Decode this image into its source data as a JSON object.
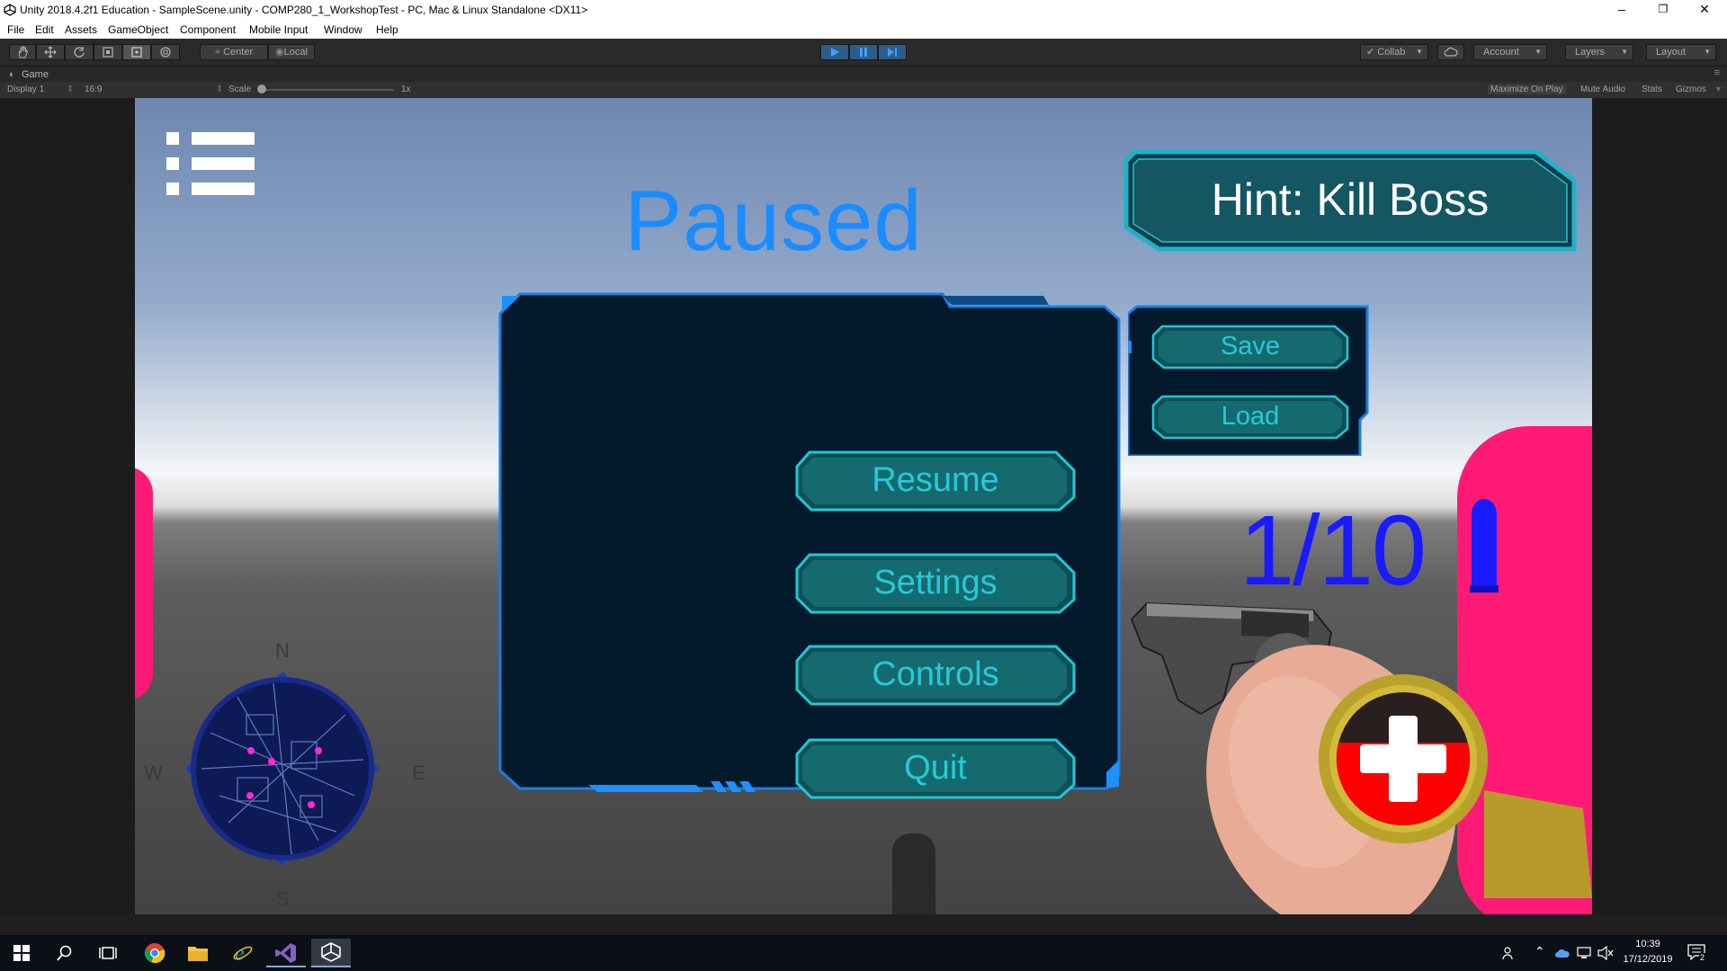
{
  "window": {
    "title": "Unity 2018.4.2f1 Education - SampleScene.unity - COMP280_1_WorkshopTest - PC, Mac & Linux Standalone <DX11>",
    "controls": {
      "minimize": "–",
      "restore": "❐",
      "close": "✕"
    }
  },
  "menu": [
    "File",
    "Edit",
    "Assets",
    "GameObject",
    "Component",
    "Mobile Input",
    "Window",
    "Help"
  ],
  "toolbar": {
    "pivot_center": "Center",
    "pivot_local": "Local",
    "collab": "Collab",
    "account": "Account",
    "layers": "Layers",
    "layout": "Layout",
    "play_state": "playing",
    "accent": "#2e5c8a"
  },
  "game_tab": {
    "label": "Game",
    "display": "Display 1",
    "aspect": "16:9",
    "scale_label": "Scale",
    "scale_value": "1x",
    "options": [
      "Maximize On Play",
      "Mute Audio",
      "Stats",
      "Gizmos"
    ]
  },
  "game": {
    "paused_title": "Paused",
    "hint": "Hint: Kill Boss",
    "menu_buttons": [
      "Resume",
      "Settings",
      "Controls",
      "Quit"
    ],
    "side_buttons": [
      "Save",
      "Load"
    ],
    "ammo": "1/10",
    "compass": {
      "n": "N",
      "e": "E",
      "s": "S",
      "w": "W"
    },
    "colors": {
      "paused": "#1a8cff",
      "button_text": "#27c9d6",
      "panel_border": "#1e90ff",
      "enemy": "#ff1a75",
      "ammo": "#1a1aff"
    }
  },
  "taskbar": {
    "apps": [
      "windows-start",
      "search",
      "task-view",
      "chrome",
      "file-explorer",
      "internet-explorer",
      "visual-studio",
      "unity"
    ],
    "time": "10:39",
    "date": "17/12/2019",
    "notifications": "2"
  }
}
